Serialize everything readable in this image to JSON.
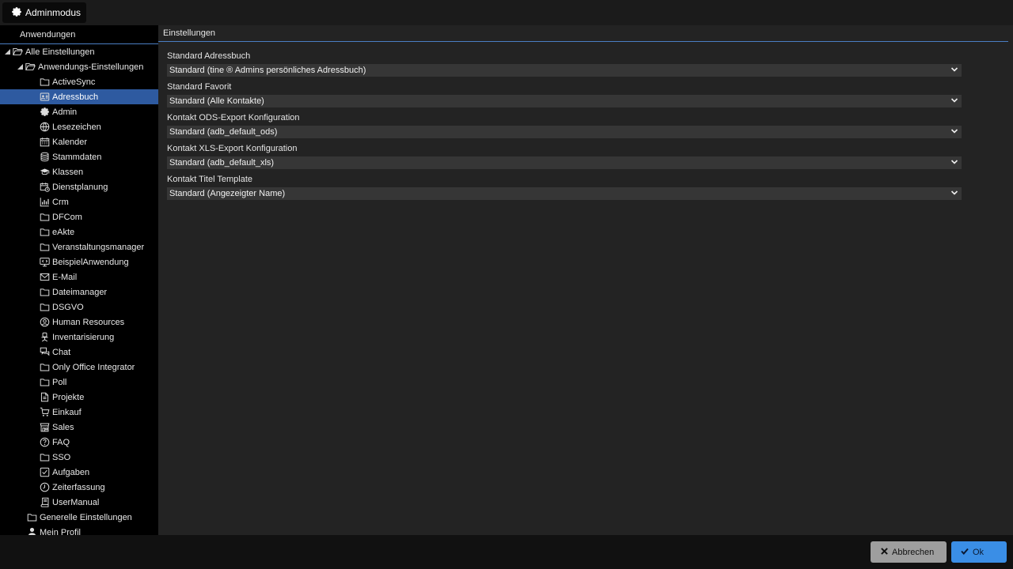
{
  "topbar": {
    "admin_label": "Adminmodus"
  },
  "sidebar": {
    "header": "Anwendungen",
    "root": {
      "label": "Alle Einstellungen",
      "icon": "folder-open-icon"
    },
    "app_settings": {
      "label": "Anwendungs-Einstellungen",
      "icon": "folder-open-icon"
    },
    "items": [
      {
        "label": "ActiveSync",
        "icon": "folder-icon"
      },
      {
        "label": "Adressbuch",
        "icon": "addressbook-icon",
        "selected": true
      },
      {
        "label": "Admin",
        "icon": "gear-icon"
      },
      {
        "label": "Lesezeichen",
        "icon": "globe-icon"
      },
      {
        "label": "Kalender",
        "icon": "calendar-icon"
      },
      {
        "label": "Stammdaten",
        "icon": "database-icon"
      },
      {
        "label": "Klassen",
        "icon": "graduation-cap-icon"
      },
      {
        "label": "Dienstplanung",
        "icon": "calendar-clock-icon"
      },
      {
        "label": "Crm",
        "icon": "bar-chart-icon"
      },
      {
        "label": "DFCom",
        "icon": "folder-icon"
      },
      {
        "label": "eAkte",
        "icon": "folder-icon"
      },
      {
        "label": "Veranstaltungsmanager",
        "icon": "folder-icon"
      },
      {
        "label": "BeispielAnwendung",
        "icon": "monitor-code-icon"
      },
      {
        "label": "E-Mail",
        "icon": "envelope-icon"
      },
      {
        "label": "Dateimanager",
        "icon": "folder-icon"
      },
      {
        "label": "DSGVO",
        "icon": "folder-icon"
      },
      {
        "label": "Human Resources",
        "icon": "user-circle-icon"
      },
      {
        "label": "Inventarisierung",
        "icon": "office-chair-icon"
      },
      {
        "label": "Chat",
        "icon": "chat-icon"
      },
      {
        "label": "Only Office Integrator",
        "icon": "folder-icon"
      },
      {
        "label": "Poll",
        "icon": "folder-icon"
      },
      {
        "label": "Projekte",
        "icon": "document-icon"
      },
      {
        "label": "Einkauf",
        "icon": "cart-icon"
      },
      {
        "label": "Sales",
        "icon": "store-icon"
      },
      {
        "label": "FAQ",
        "icon": "question-circle-icon"
      },
      {
        "label": "SSO",
        "icon": "folder-icon"
      },
      {
        "label": "Aufgaben",
        "icon": "checkbox-icon"
      },
      {
        "label": "Zeiterfassung",
        "icon": "clock-icon"
      },
      {
        "label": "UserManual",
        "icon": "book-icon"
      }
    ],
    "general": {
      "label": "Generelle Einstellungen",
      "icon": "folder-icon"
    },
    "profile": {
      "label": "Mein Profil",
      "icon": "user-icon"
    }
  },
  "main": {
    "header": "Einstellungen",
    "fields": [
      {
        "label": "Standard Adressbuch",
        "value": "Standard (tine ® Admins persönliches Adressbuch)"
      },
      {
        "label": "Standard Favorit",
        "value": "Standard (Alle Kontakte)"
      },
      {
        "label": "Kontakt ODS-Export Konfiguration",
        "value": "Standard (adb_default_ods)"
      },
      {
        "label": "Kontakt XLS-Export Konfiguration",
        "value": "Standard (adb_default_xls)"
      },
      {
        "label": "Kontakt Titel Template",
        "value": "Standard (Angezeigter Name)"
      }
    ]
  },
  "footer": {
    "cancel_label": "Abbrechen",
    "ok_label": "Ok"
  },
  "colors": {
    "selected": "#2e5aa0",
    "ok": "#3a8ee6",
    "cancel": "#9e9e9e",
    "accent_line": "#4a7ec2"
  }
}
